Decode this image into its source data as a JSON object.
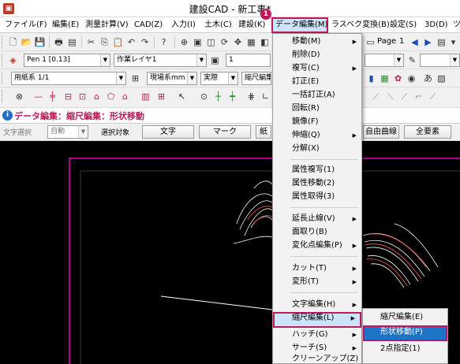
{
  "window": {
    "title": "建設CAD - 新工事*"
  },
  "menubar": {
    "items": [
      "ファイル(F)",
      "編集(E)",
      "測量計算(V)",
      "CAD(Z)",
      "入力(I)",
      "土木(C)",
      "建設(K)",
      "データ編集(M)",
      "ラスベク変換(B)",
      "設定(S)",
      "3D(D)",
      "ツ"
    ]
  },
  "toolbar2": {
    "pen_select": "Pen 1 [0.13]",
    "layer_select": "作業レイヤ1",
    "line_value": "1"
  },
  "toolbar1": {
    "page_label": "Page",
    "page_value": "1"
  },
  "toolbar3": {
    "paper_select": "用紙系 1/1",
    "unit_select": "現場系mm",
    "scale_select": "実際",
    "mode_select": "縮尺編集"
  },
  "modebar": {
    "text": "データ編集：縮尺編集：形状移動"
  },
  "optbar": {
    "char_select_label": "文字選択",
    "char_select_value": "自動",
    "target_label": "選択対象",
    "moji_button": "文字",
    "mark_button": "マーク",
    "partial_button": "紙",
    "curve_button": "自由曲線",
    "all_button": "全要素"
  },
  "dropdown": {
    "items": [
      {
        "label": "移動(M)",
        "submenu": true
      },
      {
        "label": "削除(D)",
        "submenu": false
      },
      {
        "label": "複写(C)",
        "submenu": true
      },
      {
        "label": "訂正(E)",
        "submenu": false
      },
      {
        "label": "一括訂正(A)",
        "submenu": false
      },
      {
        "label": "回転(R)",
        "submenu": false
      },
      {
        "label": "鏡像(F)",
        "submenu": false
      },
      {
        "label": "伸縮(Q)",
        "submenu": true
      },
      {
        "label": "分解(X)",
        "submenu": false
      },
      {
        "label": "属性複写(1)",
        "submenu": false
      },
      {
        "label": "属性移動(2)",
        "submenu": false
      },
      {
        "label": "属性取得(3)",
        "submenu": false
      },
      {
        "label": "延長止線(V)",
        "submenu": true
      },
      {
        "label": "面取り(B)",
        "submenu": false
      },
      {
        "label": "変化点編集(P)",
        "submenu": true
      },
      {
        "label": "カット(T)",
        "submenu": true
      },
      {
        "label": "変形(T)",
        "submenu": true
      },
      {
        "label": "文字編集(H)",
        "submenu": true
      },
      {
        "label": "縮尺編集(L)",
        "submenu": true
      },
      {
        "label": "ハッチ(G)",
        "submenu": true
      },
      {
        "label": "サーチ(S)",
        "submenu": true
      },
      {
        "label": "クリーンアップ(Z)",
        "submenu": false
      }
    ]
  },
  "submenu": {
    "items": [
      "縮尺編集(E)",
      "形状移動(P)",
      "2点指定(1)"
    ]
  },
  "callout": {
    "number": "1"
  },
  "colors": {
    "accent": "#c0185a",
    "menu_highlight": "#cce4f7",
    "submenu_highlight": "#1e73c8",
    "canvas_bg": "#000000",
    "frame_magenta": "#b0008c"
  }
}
